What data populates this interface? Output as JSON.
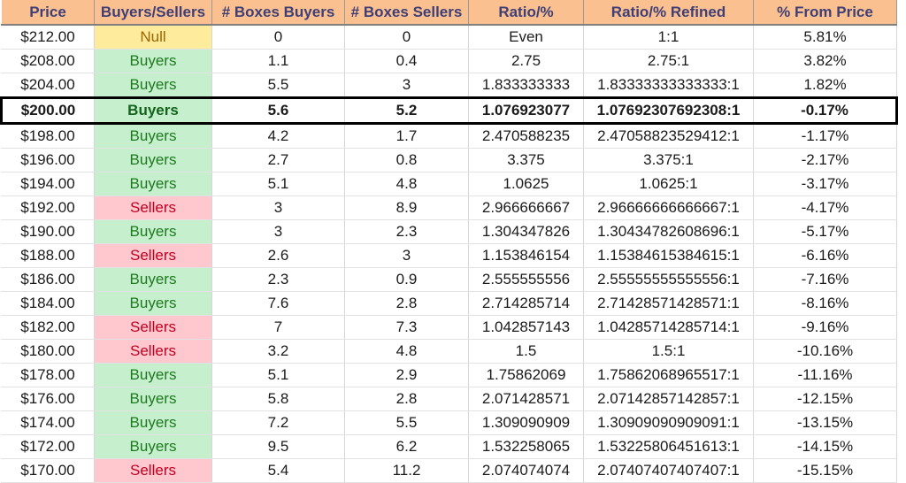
{
  "table": {
    "columns": [
      "Price",
      "Buyers/Sellers",
      "# Boxes Buyers",
      "# Boxes Sellers",
      "Ratio/%",
      "Ratio/% Refined",
      "% From Price"
    ],
    "colors": {
      "header_bg": "#fac090",
      "header_text": "#3f3f76",
      "buyers_bg": "#c6efce",
      "buyers_text": "#1e7a1e",
      "sellers_bg": "#ffc7ce",
      "sellers_text": "#c00021",
      "null_bg": "#ffeb9c",
      "null_text": "#9c6500",
      "focus_border": "#000000"
    },
    "focus_row_index": 3,
    "rows": [
      {
        "price": "$212.00",
        "side": "Null",
        "side_key": "null",
        "boxes_buyers": "0",
        "boxes_sellers": "0",
        "ratio": "Even",
        "ratio_refined": "1:1",
        "pct_from_price": "5.81%"
      },
      {
        "price": "$208.00",
        "side": "Buyers",
        "side_key": "buyers",
        "boxes_buyers": "1.1",
        "boxes_sellers": "0.4",
        "ratio": "2.75",
        "ratio_refined": "2.75:1",
        "pct_from_price": "3.82%"
      },
      {
        "price": "$204.00",
        "side": "Buyers",
        "side_key": "buyers",
        "boxes_buyers": "5.5",
        "boxes_sellers": "3",
        "ratio": "1.833333333",
        "ratio_refined": "1.83333333333333:1",
        "pct_from_price": "1.82%"
      },
      {
        "price": "$200.00",
        "side": "Buyers",
        "side_key": "buyers",
        "boxes_buyers": "5.6",
        "boxes_sellers": "5.2",
        "ratio": "1.076923077",
        "ratio_refined": "1.07692307692308:1",
        "pct_from_price": "-0.17%"
      },
      {
        "price": "$198.00",
        "side": "Buyers",
        "side_key": "buyers",
        "boxes_buyers": "4.2",
        "boxes_sellers": "1.7",
        "ratio": "2.470588235",
        "ratio_refined": "2.47058823529412:1",
        "pct_from_price": "-1.17%"
      },
      {
        "price": "$196.00",
        "side": "Buyers",
        "side_key": "buyers",
        "boxes_buyers": "2.7",
        "boxes_sellers": "0.8",
        "ratio": "3.375",
        "ratio_refined": "3.375:1",
        "pct_from_price": "-2.17%"
      },
      {
        "price": "$194.00",
        "side": "Buyers",
        "side_key": "buyers",
        "boxes_buyers": "5.1",
        "boxes_sellers": "4.8",
        "ratio": "1.0625",
        "ratio_refined": "1.0625:1",
        "pct_from_price": "-3.17%"
      },
      {
        "price": "$192.00",
        "side": "Sellers",
        "side_key": "sellers",
        "boxes_buyers": "3",
        "boxes_sellers": "8.9",
        "ratio": "2.966666667",
        "ratio_refined": "2.96666666666667:1",
        "pct_from_price": "-4.17%"
      },
      {
        "price": "$190.00",
        "side": "Buyers",
        "side_key": "buyers",
        "boxes_buyers": "3",
        "boxes_sellers": "2.3",
        "ratio": "1.304347826",
        "ratio_refined": "1.30434782608696:1",
        "pct_from_price": "-5.17%"
      },
      {
        "price": "$188.00",
        "side": "Sellers",
        "side_key": "sellers",
        "boxes_buyers": "2.6",
        "boxes_sellers": "3",
        "ratio": "1.153846154",
        "ratio_refined": "1.15384615384615:1",
        "pct_from_price": "-6.16%"
      },
      {
        "price": "$186.00",
        "side": "Buyers",
        "side_key": "buyers",
        "boxes_buyers": "2.3",
        "boxes_sellers": "0.9",
        "ratio": "2.555555556",
        "ratio_refined": "2.55555555555556:1",
        "pct_from_price": "-7.16%"
      },
      {
        "price": "$184.00",
        "side": "Buyers",
        "side_key": "buyers",
        "boxes_buyers": "7.6",
        "boxes_sellers": "2.8",
        "ratio": "2.714285714",
        "ratio_refined": "2.71428571428571:1",
        "pct_from_price": "-8.16%"
      },
      {
        "price": "$182.00",
        "side": "Sellers",
        "side_key": "sellers",
        "boxes_buyers": "7",
        "boxes_sellers": "7.3",
        "ratio": "1.042857143",
        "ratio_refined": "1.04285714285714:1",
        "pct_from_price": "-9.16%"
      },
      {
        "price": "$180.00",
        "side": "Sellers",
        "side_key": "sellers",
        "boxes_buyers": "3.2",
        "boxes_sellers": "4.8",
        "ratio": "1.5",
        "ratio_refined": "1.5:1",
        "pct_from_price": "-10.16%"
      },
      {
        "price": "$178.00",
        "side": "Buyers",
        "side_key": "buyers",
        "boxes_buyers": "5.1",
        "boxes_sellers": "2.9",
        "ratio": "1.75862069",
        "ratio_refined": "1.75862068965517:1",
        "pct_from_price": "-11.16%"
      },
      {
        "price": "$176.00",
        "side": "Buyers",
        "side_key": "buyers",
        "boxes_buyers": "5.8",
        "boxes_sellers": "2.8",
        "ratio": "2.071428571",
        "ratio_refined": "2.07142857142857:1",
        "pct_from_price": "-12.15%"
      },
      {
        "price": "$174.00",
        "side": "Buyers",
        "side_key": "buyers",
        "boxes_buyers": "7.2",
        "boxes_sellers": "5.5",
        "ratio": "1.309090909",
        "ratio_refined": "1.30909090909091:1",
        "pct_from_price": "-13.15%"
      },
      {
        "price": "$172.00",
        "side": "Buyers",
        "side_key": "buyers",
        "boxes_buyers": "9.5",
        "boxes_sellers": "6.2",
        "ratio": "1.532258065",
        "ratio_refined": "1.53225806451613:1",
        "pct_from_price": "-14.15%"
      },
      {
        "price": "$170.00",
        "side": "Sellers",
        "side_key": "sellers",
        "boxes_buyers": "5.4",
        "boxes_sellers": "11.2",
        "ratio": "2.074074074",
        "ratio_refined": "2.07407407407407:1",
        "pct_from_price": "-15.15%"
      }
    ]
  }
}
